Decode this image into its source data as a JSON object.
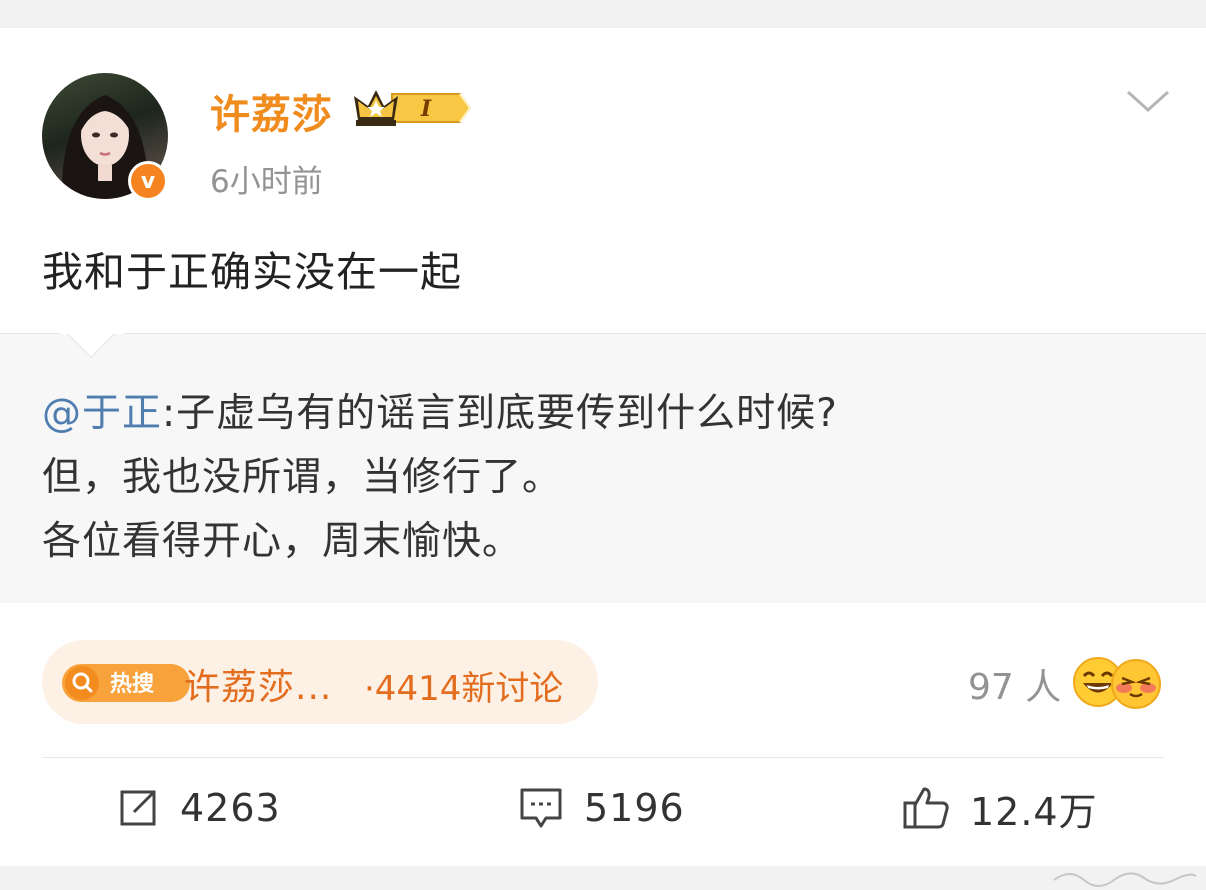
{
  "post": {
    "author": "许荔莎",
    "vip_level": "I",
    "verified_badge": "v",
    "time": "6小时前",
    "text": "我和于正确实没在一起"
  },
  "quote": {
    "mention": "@于正",
    "line1_rest": ":子虚乌有的谣言到底要传到什么时候?",
    "line2": "但，我也没所谓，当修行了。",
    "line3": "各位看得开心，周末愉快。"
  },
  "hot_search": {
    "badge": "热搜",
    "title": "许荔莎...",
    "count": "·4414新讨论"
  },
  "reactions": {
    "people": "97 人"
  },
  "actions": {
    "repost": "4263",
    "comment": "5196",
    "like": "12.4万"
  },
  "colors": {
    "username": "#f08b1d",
    "mention": "#507daf",
    "hot": "#e36d1f"
  }
}
